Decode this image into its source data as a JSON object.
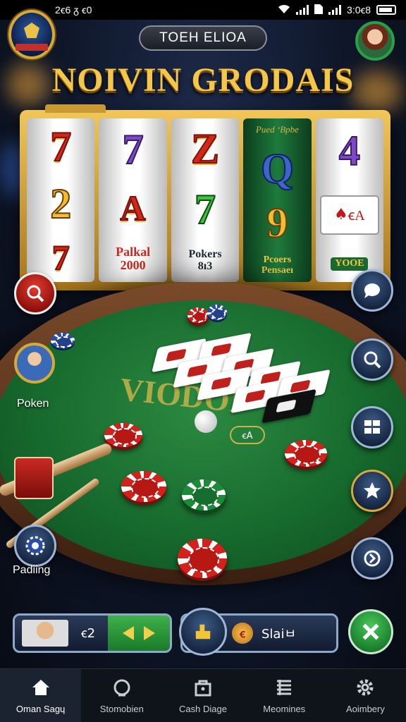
{
  "status_bar": {
    "left_text": "2ꞓ6 ᵹ ꞓ0",
    "time": "3:0ꞓ8"
  },
  "header": {
    "title_pill": "TOEH ELIOA",
    "game_title": "NOIVIN GRODAIS"
  },
  "slot": {
    "reels": [
      {
        "symbols": [
          "7",
          "2",
          "7"
        ]
      },
      {
        "symbols": [
          "7",
          "A"
        ],
        "caption": [
          "Palkal",
          "2000"
        ]
      },
      {
        "symbols": [
          "Z",
          "7"
        ],
        "caption": [
          "Pokers",
          "8ı3"
        ]
      },
      {
        "top_ribbon": "Pued ʻBpbe",
        "symbols": [
          "Q",
          "9"
        ],
        "caption": [
          "Pcoers",
          "Pensaeı"
        ]
      },
      {
        "symbols": [
          "4"
        ],
        "card_label": "ꞓA",
        "bottom_text": "YOOE"
      }
    ]
  },
  "table": {
    "felt_text": "VIODOI",
    "felt_badge": "ꞓA"
  },
  "side_left": {
    "player_label": "Poken",
    "bottom_label": "Padiing"
  },
  "bottom_controls": {
    "left_value": "ꞓ2",
    "right_label": "Slaiㅂ",
    "coin_glyph": "ꞓ"
  },
  "bottom_nav": {
    "items": [
      {
        "label": "Oman Sagɥ",
        "icon": "home-icon"
      },
      {
        "label": "Stomobien",
        "icon": "ring-icon"
      },
      {
        "label": "Cash Diage",
        "icon": "bag-icon"
      },
      {
        "label": "Meomines",
        "icon": "list-icon"
      },
      {
        "label": "Aoimbery",
        "icon": "gear-icon"
      }
    ]
  },
  "colors": {
    "title_gold": "#f4c64a",
    "felt_green": "#176a2e",
    "accent_green": "#3fb14a",
    "chip_red": "#d4211c"
  }
}
